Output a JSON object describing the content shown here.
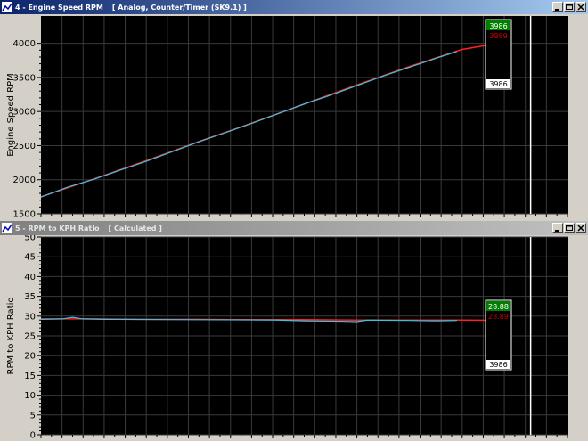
{
  "windows": [
    {
      "title": "4 - Engine Speed RPM",
      "source": "[ Analog, Counter/Timer (SK9.1) ]",
      "active": true
    },
    {
      "title": "5 - RPM to KPH Ratio",
      "source": "[ Calculated ]",
      "active": false
    }
  ],
  "colors": {
    "plot_bg": "#000000",
    "grid": "#3a3a3a",
    "series_red": "#ff2020",
    "series_cyan": "#40c0e0",
    "cursor_line": "#ffffff",
    "readout_green": "#008000",
    "readout_red": "#cc0000"
  },
  "chart_data": [
    {
      "type": "line",
      "title": "4 - Engine Speed RPM",
      "ylabel": "Engine Speed RPM",
      "xlabel": "",
      "ylim": [
        1500,
        4400
      ],
      "yticks": [
        1500,
        2000,
        2500,
        3000,
        3500,
        4000
      ],
      "grid": true,
      "x_range": [
        0,
        100
      ],
      "series": [
        {
          "color": "red",
          "x": [
            0,
            10,
            20,
            30,
            40,
            50,
            60,
            70,
            80,
            89
          ],
          "values": [
            1750,
            2010,
            2280,
            2560,
            2830,
            3110,
            3390,
            3660,
            3910,
            4030
          ]
        },
        {
          "color": "cyan",
          "x": [
            0,
            5,
            10,
            15,
            20,
            30,
            40,
            50,
            55,
            60,
            65,
            70,
            75,
            79
          ],
          "values": [
            1745,
            1890,
            2005,
            2140,
            2270,
            2555,
            2825,
            3110,
            3240,
            3380,
            3520,
            3650,
            3780,
            3880
          ]
        }
      ],
      "cursor_x": 93,
      "readout": {
        "top": "3986",
        "mid": "3989",
        "bottom": "3986"
      }
    },
    {
      "type": "line",
      "title": "5 - RPM to KPH Ratio",
      "ylabel": "RPM to KPH Ratio",
      "xlabel": "",
      "ylim": [
        0,
        50
      ],
      "yticks": [
        0,
        5,
        10,
        15,
        20,
        25,
        30,
        35,
        40,
        45,
        50
      ],
      "grid": true,
      "x_range": [
        0,
        100
      ],
      "series": [
        {
          "color": "red",
          "x": [
            0,
            10,
            20,
            30,
            40,
            50,
            60,
            70,
            80,
            89
          ],
          "values": [
            29.3,
            29.3,
            29.2,
            29.2,
            29.1,
            29.1,
            29.0,
            29.0,
            29.0,
            28.9
          ]
        },
        {
          "color": "cyan",
          "x": [
            0,
            4,
            6,
            8,
            12,
            30,
            45,
            50,
            57,
            60,
            62,
            70,
            75,
            79
          ],
          "values": [
            29.2,
            29.3,
            29.7,
            29.3,
            29.2,
            29.1,
            29.0,
            28.8,
            28.7,
            28.6,
            29.0,
            28.9,
            28.8,
            28.9
          ]
        }
      ],
      "cursor_x": 93,
      "readout": {
        "top": "28.88",
        "mid": "28.89",
        "bottom": "3986"
      }
    }
  ]
}
